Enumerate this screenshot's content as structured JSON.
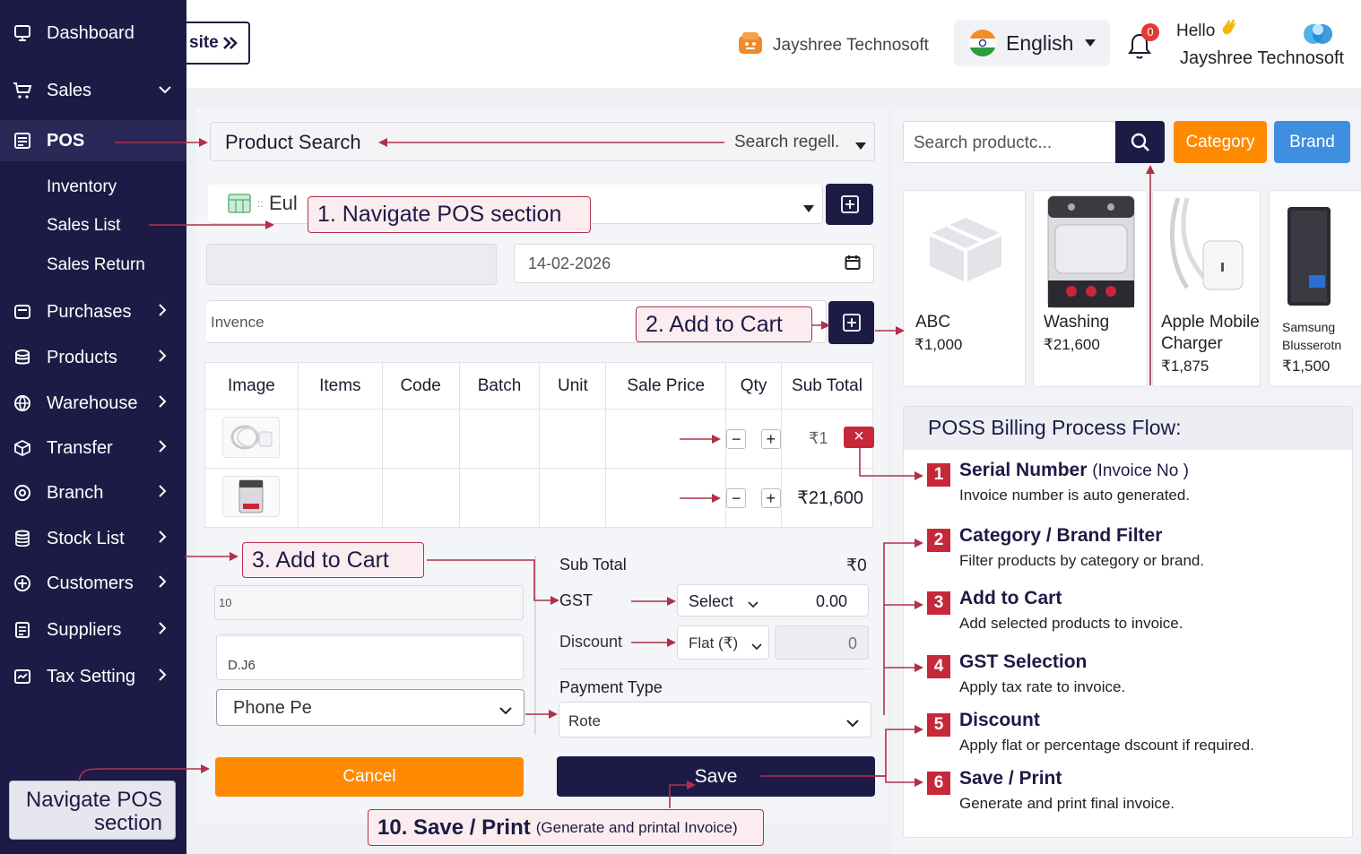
{
  "sidebar": {
    "items": [
      {
        "label": "Dashboard",
        "icon": "monitor-icon"
      },
      {
        "label": "Sales",
        "icon": "cart-icon",
        "chevron": "down"
      },
      {
        "label": "POS",
        "icon": "document-icon",
        "active": true
      },
      {
        "label": "Purchases",
        "icon": "receipt-icon",
        "chevron": "right"
      },
      {
        "label": "Products",
        "icon": "database-icon",
        "chevron": "right"
      },
      {
        "label": "Warehouse",
        "icon": "globe-icon",
        "chevron": "right"
      },
      {
        "label": "Transfer",
        "icon": "box-icon",
        "chevron": "right"
      },
      {
        "label": "Branch",
        "icon": "branch-icon",
        "chevron": "right"
      },
      {
        "label": "Stock List",
        "icon": "stack-icon",
        "chevron": "right"
      },
      {
        "label": "Customers",
        "icon": "customers-icon",
        "chevron": "right"
      },
      {
        "label": "Suppliers",
        "icon": "list-icon",
        "chevron": "right"
      },
      {
        "label": "Tax Setting",
        "icon": "tax-icon",
        "chevron": "right"
      }
    ],
    "sub_items": [
      "Inventory",
      "Sales List",
      "Sales Return"
    ],
    "nav_hint": "Navigate POS section"
  },
  "header": {
    "site_button": "site",
    "company": "Jayshree Technosoft",
    "language": "English",
    "notification_count": "0",
    "hello": "Hello",
    "user": "Jayshree Technosoft"
  },
  "pos": {
    "product_search_label": "Product Search",
    "search_placeholder": "Search regell.",
    "customer_value": "Eul",
    "date": "14-02-2026",
    "invoice_label": "Invence",
    "columns": [
      "Image",
      "Items",
      "Code",
      "Batch",
      "Unit",
      "Sale Price",
      "Qty",
      "Sub Total"
    ],
    "rows": [
      {
        "subtotal": "₹1",
        "qty_minus": "−",
        "qty_plus": "+",
        "remove": "×"
      },
      {
        "subtotal": "₹21,600",
        "qty_minus": "−",
        "qty_plus": "+"
      }
    ],
    "note_field_1": "10",
    "note_field_2": "D.J6",
    "payment_method": "Phone Pe",
    "summary": {
      "sub_total_label": "Sub Total",
      "sub_total_value": "₹0",
      "gst_label": "GST",
      "gst_select": "Select",
      "gst_value": "0.00",
      "discount_label": "Discount",
      "discount_type": "Flat (₹)",
      "discount_value": "0",
      "payment_type_label": "Payment Type",
      "payment_type_value": "Rote"
    },
    "cancel_label": "Cancel",
    "save_label": "Save"
  },
  "callouts": {
    "c1": "1. Navigate POS section",
    "c2": "2. Add to Cart",
    "c3": "3. Add to Cart",
    "c10_bold": "10. Save / Print",
    "c10_small": "(Generate and printal Invoice)"
  },
  "catalog": {
    "search_placeholder": "Search productc...",
    "category_label": "Category",
    "brand_label": "Brand",
    "products": [
      {
        "name": "ABC",
        "price": "₹1,000"
      },
      {
        "name": "Washing",
        "price": "₹21,600"
      },
      {
        "name": "Apple Mobile Charger",
        "name1": "Apple Mobile",
        "name2": "Charger",
        "price": "₹1,875"
      },
      {
        "name": "Samsung Blusserotn",
        "name1": "Samsung",
        "name2": "Blusserotn",
        "price": "₹1,500"
      }
    ]
  },
  "flow": {
    "title": "POSS Billing Process Flow:",
    "steps": [
      {
        "num": "1",
        "title": "Serial Number",
        "title_note": "(Invoice No )",
        "desc": "Invoice number is auto generated."
      },
      {
        "num": "2",
        "title": "Category / Brand Filter",
        "title_note": "",
        "desc": "Filter products by category or brand."
      },
      {
        "num": "3",
        "title": "Add to Cart",
        "title_note": "",
        "desc": "Add selected products to invoice."
      },
      {
        "num": "4",
        "title": "GST Selection",
        "title_note": "",
        "desc": "Apply tax rate to  invoice."
      },
      {
        "num": "5",
        "title": "Discount",
        "title_note": "",
        "desc": "Apply flat or percentage dscount if required."
      },
      {
        "num": "6",
        "title": "Save / Print",
        "title_note": "",
        "desc": "Generate and print final invoice."
      }
    ]
  },
  "colors": {
    "sidebar": "#1d1b45",
    "accent_orange": "#ff8a00",
    "accent_blue": "#3f8ee0",
    "annotation": "#b0304a",
    "step_badge": "#c62839"
  }
}
